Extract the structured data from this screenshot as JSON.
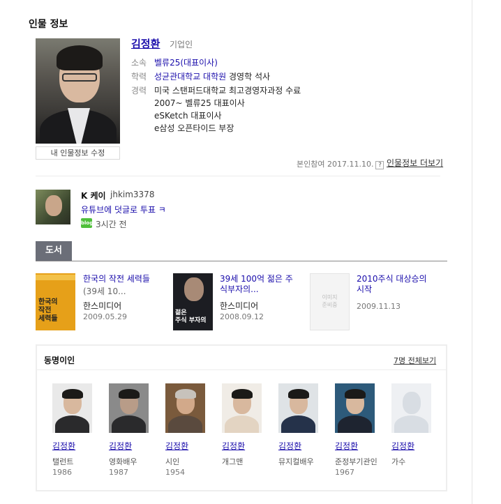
{
  "section_title": "인물 정보",
  "profile": {
    "name": "김정환",
    "job": "기업인",
    "edit_button": "내 인물정보 수정",
    "affiliation_label": "소속",
    "affiliation_value": "벨류25(대표이사)",
    "education_label": "학력",
    "education_school": "성균관대학교 대학원",
    "education_degree": "경영학 석사",
    "career_label": "경력",
    "career": [
      "미국 스탠퍼드대학교 최고경영자과정 수료",
      "2007~ 벨류25 대표이사",
      "eSKetch 대표이사",
      "e삼성 오픈타이드 부장"
    ],
    "confirm_text": "본인참여 2017.11.10.",
    "help_icon": "?",
    "more_link": "인물정보 더보기"
  },
  "blog": {
    "author": "K 케이",
    "id": "jhkim3378",
    "title": "유튜브에 덧글로 투표 ㅋ",
    "badge": "blog",
    "time": "3시간 전"
  },
  "books": {
    "tab_label": "도서",
    "items": [
      {
        "title": "한국의 작전 세력들",
        "sub": "(39세 10...",
        "publisher": "한스미디어",
        "date": "2009.05.29",
        "cover_text": "한국의\n작전\n세력들"
      },
      {
        "title_line1": "39세 100억 젊은 주",
        "title_line2": "식부자의...",
        "publisher": "한스미디어",
        "date": "2008.09.12",
        "cover_text": "젊은\n주식 부자의"
      },
      {
        "title_line1": "2010주식 대상승의",
        "title_line2": "시작",
        "date": "2009.11.13",
        "cover_text": "이미지\n준비중"
      }
    ]
  },
  "same_name": {
    "title": "동명이인",
    "view_all": "7명 전체보기",
    "people": [
      {
        "name": "김정환",
        "job": "탤런트",
        "year": "1986"
      },
      {
        "name": "김정환",
        "job": "영화배우",
        "year": "1987"
      },
      {
        "name": "김정환",
        "job": "시인",
        "year": "1954"
      },
      {
        "name": "김정환",
        "job": "개그맨",
        "year": ""
      },
      {
        "name": "김정환",
        "job": "뮤지컬배우",
        "year": ""
      },
      {
        "name": "김정환",
        "job": "준정부기관인",
        "year": "1967"
      },
      {
        "name": "김정환",
        "job": "가수",
        "year": ""
      }
    ]
  }
}
